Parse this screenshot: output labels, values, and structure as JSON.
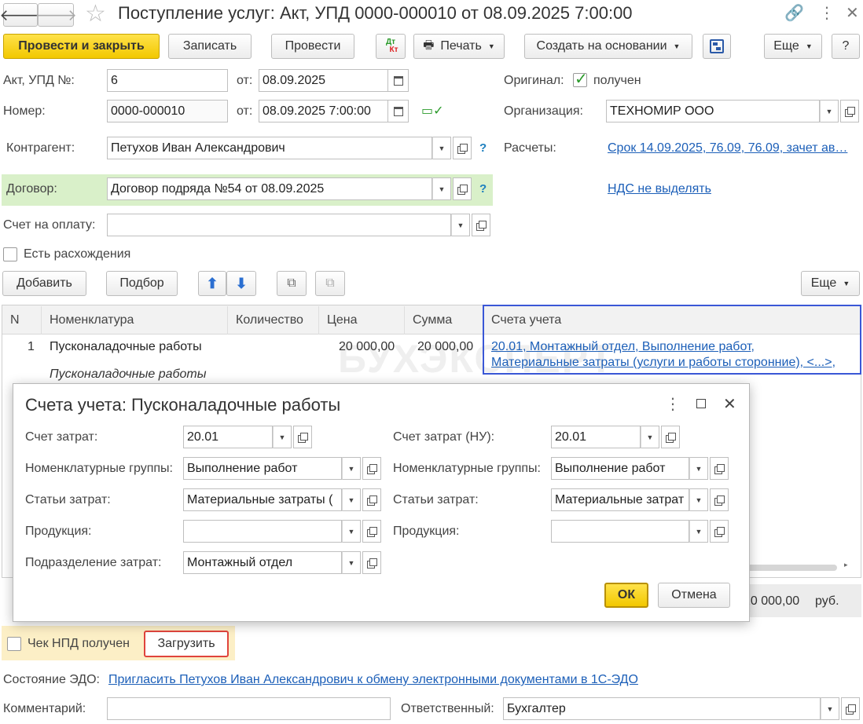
{
  "window": {
    "title": "Поступление услуг: Акт, УПД 0000-000010 от 08.09.2025 7:00:00"
  },
  "toolbar": {
    "post_close": "Провести и закрыть",
    "save": "Записать",
    "post": "Провести",
    "dt_kt_top": "Дт",
    "dt_kt_bottom": "Кт",
    "print": "Печать",
    "create_based": "Создать на основании",
    "more": "Еще",
    "help": "?"
  },
  "header": {
    "act_label": "Акт, УПД №:",
    "act_value": "6",
    "from_label": "от:",
    "act_date": "08.09.2025",
    "number_label": "Номер:",
    "number_value": "0000-000010",
    "number_date": "08.09.2025  7:00:00",
    "original_label": "Оригинал:",
    "original_received": "получен",
    "org_label": "Организация:",
    "org_value": "ТЕХНОМИР ООО",
    "counterparty_label": "Контрагент:",
    "counterparty_value": "Петухов Иван Александрович",
    "settlements_label": "Расчеты:",
    "settlements_link": "Срок 14.09.2025, 76.09, 76.09, зачет ав…",
    "contract_label": "Договор:",
    "contract_value": "Договор подряда №54 от 08.09.2025",
    "vat_link": "НДС не выделять",
    "invoice_label": "Счет на оплату:",
    "invoice_value": "",
    "discrepancy_label": "Есть расхождения",
    "help_q": "?"
  },
  "table_toolbar": {
    "add": "Добавить",
    "pick": "Подбор",
    "more": "Еще"
  },
  "table": {
    "columns": [
      "N",
      "Номенклатура",
      "Количество",
      "Цена",
      "Сумма",
      "Счета учета"
    ],
    "rows": [
      {
        "n": "1",
        "name": "Пусконаладочные работы",
        "name_sub": "Пусконаладочные работы",
        "qty": "",
        "price": "20 000,00",
        "sum": "20 000,00",
        "accounts_line1": "20.01, Монтажный отдел, Выполнение работ,",
        "accounts_line2": "Материальные затраты (услуги и работы сторонние), <...>,"
      }
    ]
  },
  "totals": {
    "amount": "20 000,00",
    "currency": "руб."
  },
  "npd": {
    "check_label": "Чек НПД получен",
    "load": "Загрузить"
  },
  "edo": {
    "label": "Состояние ЭДО:",
    "link": "Пригласить Петухов Иван Александрович к обмену электронными документами в 1С-ЭДО"
  },
  "footer": {
    "comment_label": "Комментарий:",
    "comment_value": "",
    "responsible_label": "Ответственный:",
    "responsible_value": "Бухгалтер"
  },
  "dialog": {
    "title": "Счета учета: Пусконаладочные работы",
    "left": {
      "cost_account_label": "Счет затрат:",
      "cost_account_value": "20.01",
      "nom_groups_label": "Номенклатурные группы:",
      "nom_groups_value": "Выполнение работ",
      "cost_items_label": "Статьи затрат:",
      "cost_items_value": "Материальные затраты (",
      "product_label": "Продукция:",
      "product_value": "",
      "division_label": "Подразделение затрат:",
      "division_value": "Монтажный отдел"
    },
    "right": {
      "cost_account_label": "Счет затрат (НУ):",
      "cost_account_value": "20.01",
      "nom_groups_label": "Номенклатурные группы:",
      "nom_groups_value": "Выполнение работ",
      "cost_items_label": "Статьи затрат:",
      "cost_items_value": "Материальные затрат",
      "product_label": "Продукция:",
      "product_value": ""
    },
    "ok": "ОК",
    "cancel": "Отмена"
  },
  "watermark": "БУХЭКСПЕРТ",
  "colors": {
    "accent_yellow": "#f5d000",
    "highlight_blue": "#3a57d6",
    "highlight_red": "#e0443c",
    "contract_bg": "#d9f0c9",
    "npd_bg": "#fcefc6",
    "link": "#1c5fb8"
  }
}
